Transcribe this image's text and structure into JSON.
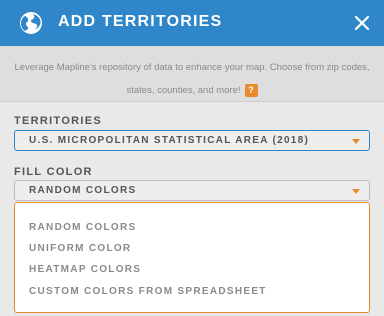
{
  "header": {
    "title": "ADD TERRITORIES",
    "icon": "globe-icon",
    "close_icon": "close-icon",
    "background": "#2f86c8"
  },
  "description": {
    "line1": "Leverage Mapline's repository of data to enhance your map. Choose from zip codes,",
    "line2": "states, counties, and more!",
    "help_label": "?"
  },
  "territories": {
    "label": "TERRITORIES",
    "selected": "U.S. MICROPOLITAN STATISTICAL AREA (2018)"
  },
  "fill_color": {
    "label": "FILL COLOR",
    "selected": "RANDOM COLORS",
    "options": [
      "RANDOM COLORS",
      "UNIFORM COLOR",
      "HEATMAP COLORS",
      "CUSTOM COLORS FROM SPREADSHEET"
    ]
  },
  "colors": {
    "accent": "#e78a2b",
    "focus_border": "#2f86c8"
  }
}
